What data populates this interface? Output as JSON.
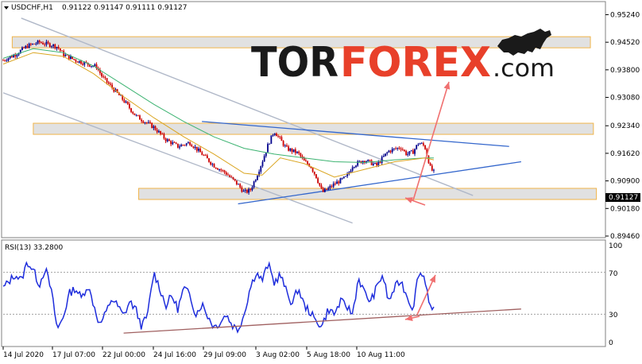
{
  "header": {
    "symbol_label": "USDCHF,H1",
    "ohlc": "0.91122 0.91147 0.91111 0.91127"
  },
  "logo": {
    "part1": "TOR",
    "part2": "FOREX",
    "part3": ".com",
    "color_dark": "#1a1a1a",
    "color_red": "#e8402a"
  },
  "rsi": {
    "label": "RSI(13) 33.2800",
    "levels": [
      "100",
      "70",
      "30",
      "0"
    ]
  },
  "chart_data": [
    {
      "type": "line",
      "name": "USDCHF,H1",
      "ylim": [
        0.8946,
        0.9554
      ],
      "y_ticks": [
        "0.95240",
        "0.94520",
        "0.93800",
        "0.93080",
        "0.92340",
        "0.91620",
        "0.90900",
        "0.90180",
        "0.89460"
      ],
      "current_price": "0.91127",
      "x_ticks": [
        "14 Jul 2020",
        "17 Jul 07:00",
        "22 Jul 00:00",
        "24 Jul 16:00",
        "29 Jul 09:00",
        "3 Aug 02:00",
        "5 Aug 18:00",
        "10 Aug 11:00"
      ],
      "price_path": [
        [
          0.0,
          0.9405
        ],
        [
          0.02,
          0.942
        ],
        [
          0.04,
          0.9442
        ],
        [
          0.06,
          0.9452
        ],
        [
          0.07,
          0.9448
        ],
        [
          0.08,
          0.9445
        ],
        [
          0.09,
          0.944
        ],
        [
          0.1,
          0.942
        ],
        [
          0.12,
          0.9405
        ],
        [
          0.14,
          0.9395
        ],
        [
          0.155,
          0.9388
        ],
        [
          0.165,
          0.936
        ],
        [
          0.18,
          0.9335
        ],
        [
          0.2,
          0.93
        ],
        [
          0.22,
          0.926
        ],
        [
          0.24,
          0.924
        ],
        [
          0.25,
          0.923
        ],
        [
          0.27,
          0.9198
        ],
        [
          0.29,
          0.918
        ],
        [
          0.31,
          0.919
        ],
        [
          0.33,
          0.916
        ],
        [
          0.35,
          0.913
        ],
        [
          0.37,
          0.911
        ],
        [
          0.39,
          0.908
        ],
        [
          0.4,
          0.906
        ],
        [
          0.41,
          0.9065
        ],
        [
          0.42,
          0.91
        ],
        [
          0.43,
          0.914
        ],
        [
          0.44,
          0.9185
        ],
        [
          0.45,
          0.922
        ],
        [
          0.46,
          0.9198
        ],
        [
          0.47,
          0.9175
        ],
        [
          0.49,
          0.9162
        ],
        [
          0.5,
          0.914
        ],
        [
          0.51,
          0.913
        ],
        [
          0.52,
          0.91
        ],
        [
          0.53,
          0.906
        ],
        [
          0.54,
          0.907
        ],
        [
          0.55,
          0.9082
        ],
        [
          0.57,
          0.91
        ],
        [
          0.58,
          0.913
        ],
        [
          0.6,
          0.9145
        ],
        [
          0.62,
          0.913
        ],
        [
          0.63,
          0.915
        ],
        [
          0.64,
          0.9168
        ],
        [
          0.66,
          0.9178
        ],
        [
          0.67,
          0.916
        ],
        [
          0.68,
          0.9165
        ],
        [
          0.69,
          0.919
        ],
        [
          0.7,
          0.918
        ],
        [
          0.71,
          0.912
        ],
        [
          0.715,
          0.9113
        ]
      ],
      "ma_slow": [
        [
          0.0,
          0.941
        ],
        [
          0.05,
          0.9435
        ],
        [
          0.1,
          0.9425
        ],
        [
          0.15,
          0.939
        ],
        [
          0.2,
          0.934
        ],
        [
          0.25,
          0.929
        ],
        [
          0.3,
          0.9245
        ],
        [
          0.35,
          0.9205
        ],
        [
          0.4,
          0.9175
        ],
        [
          0.45,
          0.916
        ],
        [
          0.5,
          0.915
        ],
        [
          0.55,
          0.914
        ],
        [
          0.6,
          0.9138
        ],
        [
          0.65,
          0.9145
        ],
        [
          0.7,
          0.915
        ],
        [
          0.715,
          0.915
        ]
      ],
      "ma_fast": [
        [
          0.0,
          0.9395
        ],
        [
          0.05,
          0.9425
        ],
        [
          0.1,
          0.9415
        ],
        [
          0.15,
          0.937
        ],
        [
          0.2,
          0.931
        ],
        [
          0.25,
          0.9255
        ],
        [
          0.3,
          0.9205
        ],
        [
          0.35,
          0.916
        ],
        [
          0.4,
          0.911
        ],
        [
          0.43,
          0.9105
        ],
        [
          0.46,
          0.915
        ],
        [
          0.5,
          0.9135
        ],
        [
          0.55,
          0.91
        ],
        [
          0.6,
          0.912
        ],
        [
          0.65,
          0.914
        ],
        [
          0.7,
          0.915
        ],
        [
          0.715,
          0.9145
        ]
      ],
      "support_resistance_zones": [
        0.9452,
        0.9226,
        0.9056
      ],
      "trendlines": [
        {
          "from": [
            0.03,
            0.9515
          ],
          "to": [
            0.78,
            0.9052
          ]
        },
        {
          "from": [
            0.0,
            0.932
          ],
          "to": [
            0.58,
            0.898
          ]
        },
        {
          "from": [
            0.33,
            0.9245
          ],
          "to": [
            0.84,
            0.918
          ]
        },
        {
          "from": [
            0.39,
            0.903
          ],
          "to": [
            0.86,
            0.914
          ]
        }
      ]
    },
    {
      "type": "line",
      "name": "RSI(13)",
      "ylim": [
        0,
        100
      ],
      "levels": [
        70,
        30
      ],
      "rsi_path": [
        [
          0.0,
          55
        ],
        [
          0.02,
          68
        ],
        [
          0.03,
          62
        ],
        [
          0.04,
          80
        ],
        [
          0.05,
          72
        ],
        [
          0.06,
          58
        ],
        [
          0.07,
          74
        ],
        [
          0.08,
          52
        ],
        [
          0.09,
          15
        ],
        [
          0.1,
          28
        ],
        [
          0.11,
          50
        ],
        [
          0.12,
          55
        ],
        [
          0.13,
          45
        ],
        [
          0.14,
          58
        ],
        [
          0.15,
          40
        ],
        [
          0.16,
          20
        ],
        [
          0.17,
          30
        ],
        [
          0.18,
          45
        ],
        [
          0.19,
          38
        ],
        [
          0.2,
          28
        ],
        [
          0.21,
          42
        ],
        [
          0.22,
          35
        ],
        [
          0.23,
          18
        ],
        [
          0.24,
          30
        ],
        [
          0.25,
          70
        ],
        [
          0.26,
          55
        ],
        [
          0.27,
          38
        ],
        [
          0.28,
          48
        ],
        [
          0.29,
          35
        ],
        [
          0.3,
          55
        ],
        [
          0.31,
          48
        ],
        [
          0.32,
          30
        ],
        [
          0.33,
          40
        ],
        [
          0.34,
          28
        ],
        [
          0.35,
          18
        ],
        [
          0.36,
          22
        ],
        [
          0.37,
          30
        ],
        [
          0.38,
          20
        ],
        [
          0.39,
          15
        ],
        [
          0.4,
          30
        ],
        [
          0.41,
          55
        ],
        [
          0.42,
          70
        ],
        [
          0.43,
          62
        ],
        [
          0.44,
          78
        ],
        [
          0.45,
          60
        ],
        [
          0.46,
          68
        ],
        [
          0.47,
          52
        ],
        [
          0.48,
          40
        ],
        [
          0.49,
          55
        ],
        [
          0.5,
          38
        ],
        [
          0.51,
          32
        ],
        [
          0.52,
          22
        ],
        [
          0.53,
          20
        ],
        [
          0.54,
          35
        ],
        [
          0.55,
          30
        ],
        [
          0.56,
          42
        ],
        [
          0.57,
          38
        ],
        [
          0.58,
          30
        ],
        [
          0.59,
          65
        ],
        [
          0.6,
          50
        ],
        [
          0.61,
          42
        ],
        [
          0.62,
          55
        ],
        [
          0.63,
          68
        ],
        [
          0.64,
          42
        ],
        [
          0.65,
          55
        ],
        [
          0.66,
          62
        ],
        [
          0.67,
          48
        ],
        [
          0.68,
          35
        ],
        [
          0.69,
          70
        ],
        [
          0.7,
          65
        ],
        [
          0.71,
          35
        ],
        [
          0.715,
          33
        ]
      ],
      "trendline": {
        "from": [
          0.2,
          12
        ],
        "to": [
          0.86,
          35
        ]
      }
    }
  ],
  "colors": {
    "candle_up": "#00008b",
    "candle_down": "#cc0000",
    "price_line": "#8b0000",
    "ma_slow": "#3cb371",
    "ma_fast": "#daa520",
    "trend_blue": "#3366cc",
    "trend_gray": "#b0b8c8",
    "zone_fill": "#e0e0e0",
    "zone_border": "#f0b040",
    "arrow": "#f07070",
    "rsi_line": "#1e2ddc",
    "rsi_trend": "#a06060",
    "badge_bg": "#000000",
    "badge_text": "#ffffff",
    "grid": "#a0a0a0"
  }
}
